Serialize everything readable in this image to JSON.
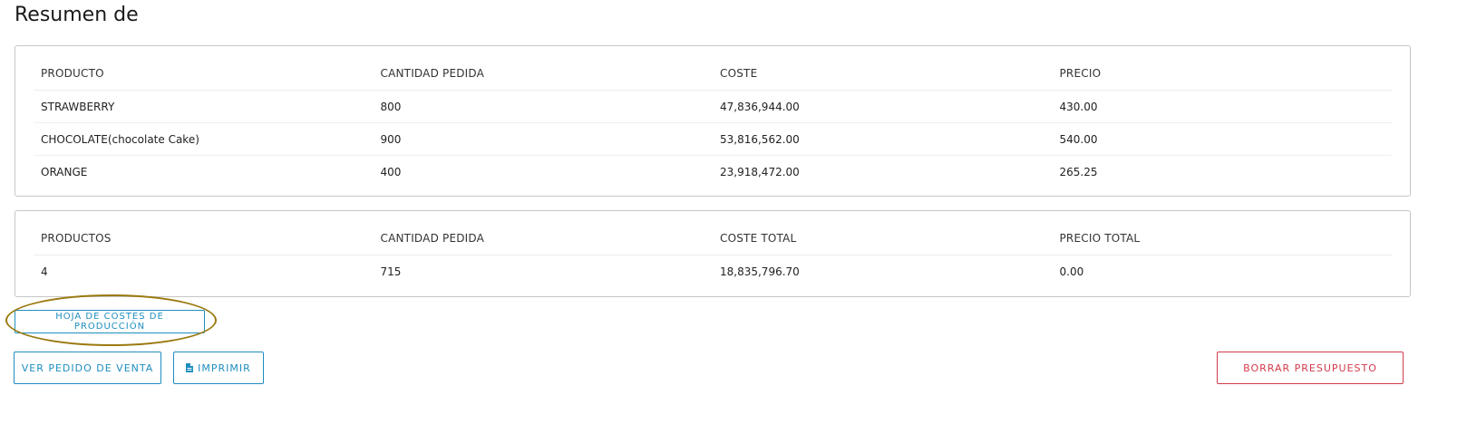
{
  "page": {
    "title": "Resumen de"
  },
  "items_table": {
    "headers": [
      "PRODUCTO",
      "CANTIDAD PEDIDA",
      "COSTE",
      "PRECIO"
    ],
    "rows": [
      [
        "STRAWBERRY",
        "800",
        "47,836,944.00",
        "430.00"
      ],
      [
        "CHOCOLATE(chocolate Cake)",
        "900",
        "53,816,562.00",
        "540.00"
      ],
      [
        "ORANGE",
        "400",
        "23,918,472.00",
        "265.25"
      ]
    ]
  },
  "totals_table": {
    "headers": [
      "PRODUCTOS",
      "CANTIDAD PEDIDA",
      "COSTE TOTAL",
      "PRECIO TOTAL"
    ],
    "rows": [
      [
        "4",
        "715",
        "18,835,796.70",
        "0.00"
      ]
    ]
  },
  "buttons": {
    "production_costs": "HOJA DE COSTES DE PRODUCCIÓN",
    "view_sales_order": "VER PEDIDO DE VENTA",
    "print": "IMPRIMIR",
    "print_icon": "file-icon",
    "delete_budget": "BORRAR PRESUPUESTO"
  },
  "colors": {
    "primary": "#1f8ec0",
    "danger": "#d23b4a",
    "highlight": "#9a7a10"
  }
}
